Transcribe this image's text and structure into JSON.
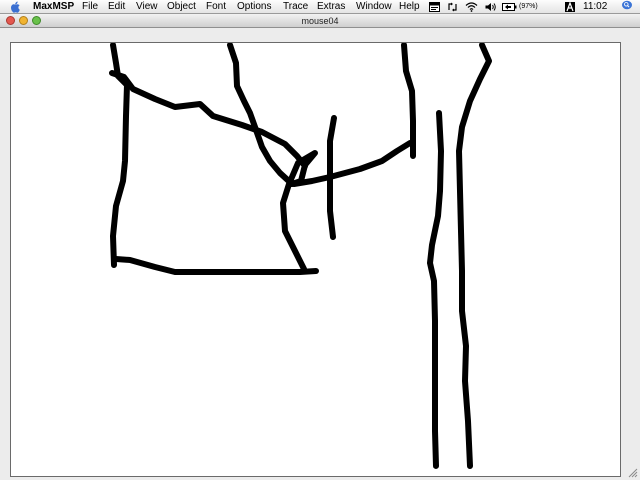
{
  "menubar": {
    "app_name": "MaxMSP",
    "items": [
      "File",
      "Edit",
      "View",
      "Object",
      "Font",
      "Options",
      "Trace",
      "Extras",
      "Window",
      "Help"
    ],
    "battery": "(97%)",
    "clock": "11:02"
  },
  "window": {
    "title": "mouse04"
  },
  "icons": {
    "apple": "apple-icon",
    "status": [
      "max-window-icon",
      "sync-icon",
      "wifi-icon",
      "volume-icon",
      "battery-icon",
      "user-icon",
      "spotlight-icon"
    ]
  }
}
